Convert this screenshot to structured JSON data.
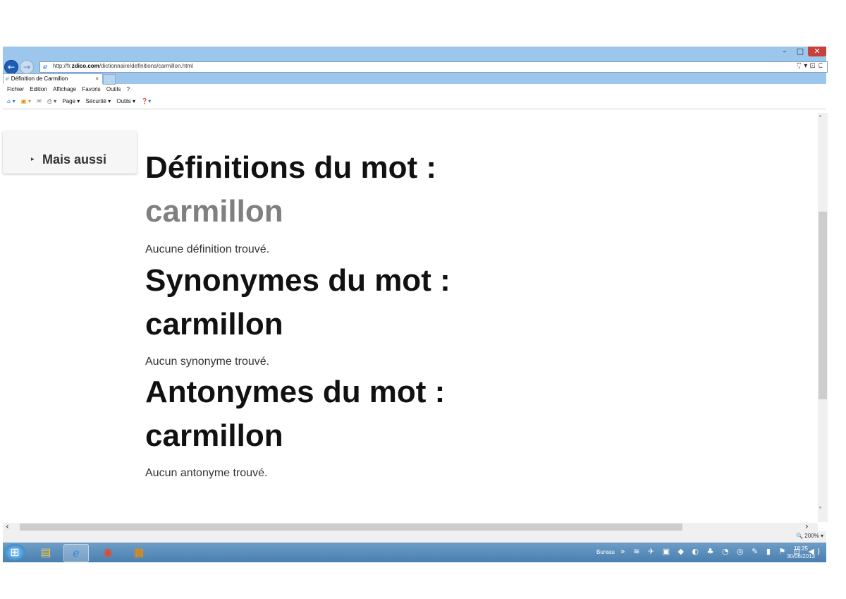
{
  "window": {
    "min": "–",
    "max": "□",
    "close": "✕"
  },
  "address": {
    "url_prefix": "http://fr.",
    "url_domain": "zdico.com",
    "url_path": "/dictionnaire/definitions/carmillon.html",
    "tools": "⚲ ▾ ⊡ C"
  },
  "chrome_icons": "⌂ ★ ⚙",
  "tab": {
    "title": "Définition de Carmillon",
    "close": "×"
  },
  "menu": [
    "Fichier",
    "Edition",
    "Affichage",
    "Favoris",
    "Outils",
    "?"
  ],
  "commands": {
    "page": "Page ▾",
    "security": "Sécurité ▾",
    "tools": "Outils ▾"
  },
  "sidebar": {
    "label": "Mais aussi"
  },
  "content": {
    "def_heading": "Définitions du mot :",
    "def_word": "carmillon",
    "def_text": "Aucune définition trouvé.",
    "syn_heading": "Synonymes du mot :",
    "syn_word": "carmillon",
    "syn_text": "Aucun synonyme trouvé.",
    "ant_heading": "Antonymes du mot :",
    "ant_word": "carmillon",
    "ant_text": "Aucun antonyme trouvé."
  },
  "status": {
    "zoom": "🔍 200% ▾"
  },
  "taskbar": {
    "tray_label": "Bureau",
    "time": "18:25",
    "date": "30/06/2013"
  }
}
